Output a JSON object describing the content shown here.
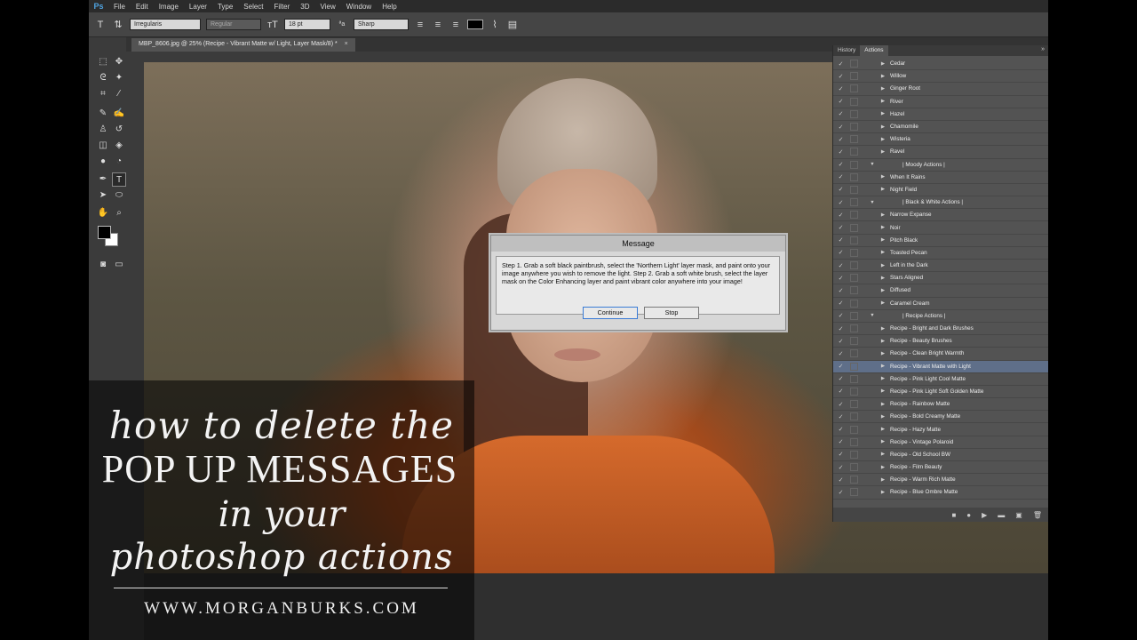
{
  "app": {
    "logo": "Ps",
    "menu": [
      "File",
      "Edit",
      "Image",
      "Layer",
      "Type",
      "Select",
      "Filter",
      "3D",
      "View",
      "Window",
      "Help"
    ]
  },
  "options": {
    "font_family": "Irregularis",
    "font_style": "Regular",
    "font_size": "18 pt",
    "aa_label": "ªa",
    "antialias": "Sharp"
  },
  "document": {
    "tab_title": "MBP_8606.jpg @ 25% (Recipe - Vibrant Matte w/ Light, Layer Mask/8) *",
    "tab_close": "×"
  },
  "dialog": {
    "title": "Message",
    "body": "Step 1. Grab a soft black paintbrush, select the 'Northern Light' layer mask, and paint onto your image anywhere you wish to remove the light. Step 2. Grab a soft white brush, select the layer mask on the Color Enhancing layer and paint vibrant color anywhere into your image!",
    "continue_label": "Continue",
    "stop_label": "Stop"
  },
  "panel": {
    "tabs": [
      "History",
      "Actions"
    ],
    "active_tab": "Actions",
    "actions": [
      {
        "label": "Cedar",
        "type": "action",
        "checked": true
      },
      {
        "label": "Willow",
        "type": "action",
        "checked": true
      },
      {
        "label": "Ginger Root",
        "type": "action",
        "checked": true
      },
      {
        "label": "River",
        "type": "action",
        "checked": true
      },
      {
        "label": "Hazel",
        "type": "action",
        "checked": true
      },
      {
        "label": "Chamomile",
        "type": "action",
        "checked": true
      },
      {
        "label": "Wisteria",
        "type": "action",
        "checked": true
      },
      {
        "label": "Ravel",
        "type": "action",
        "checked": true
      },
      {
        "label": "| Moody Actions |",
        "type": "group",
        "checked": true
      },
      {
        "label": "When It Rains",
        "type": "action",
        "checked": true
      },
      {
        "label": "Night Field",
        "type": "action",
        "checked": true
      },
      {
        "label": "| Black & White Actions |",
        "type": "group",
        "checked": true
      },
      {
        "label": "Narrow Expanse",
        "type": "action",
        "checked": true
      },
      {
        "label": "Noir",
        "type": "action",
        "checked": true
      },
      {
        "label": "Pitch Black",
        "type": "action",
        "checked": true
      },
      {
        "label": "Toasted Pecan",
        "type": "action",
        "checked": true
      },
      {
        "label": "Left in the Dark",
        "type": "action",
        "checked": true
      },
      {
        "label": "Stars Aligned",
        "type": "action",
        "checked": true
      },
      {
        "label": "Diffused",
        "type": "action",
        "checked": true
      },
      {
        "label": "Caramel Cream",
        "type": "action",
        "checked": true
      },
      {
        "label": "| Recipe Actions |",
        "type": "group",
        "checked": true
      },
      {
        "label": "Recipe - Bright and Dark Brushes",
        "type": "action",
        "checked": true
      },
      {
        "label": "Recipe - Beauty Brushes",
        "type": "action",
        "checked": true
      },
      {
        "label": "Recipe - Clean Bright Warmth",
        "type": "action",
        "checked": true
      },
      {
        "label": "Recipe - Vibrant Matte with Light",
        "type": "action",
        "checked": true,
        "selected": true
      },
      {
        "label": "Recipe - Pink Light Cool Matte",
        "type": "action",
        "checked": true
      },
      {
        "label": "Recipe - Pink Light Soft Golden Matte",
        "type": "action",
        "checked": true
      },
      {
        "label": "Recipe - Rainbow Matte",
        "type": "action",
        "checked": true
      },
      {
        "label": "Recipe - Bold Creamy Matte",
        "type": "action",
        "checked": true
      },
      {
        "label": "Recipe - Hazy Matte",
        "type": "action",
        "checked": true
      },
      {
        "label": "Recipe - Vintage Polaroid",
        "type": "action",
        "checked": true
      },
      {
        "label": "Recipe - Old School BW",
        "type": "action",
        "checked": true
      },
      {
        "label": "Recipe - Film Beauty",
        "type": "action",
        "checked": true
      },
      {
        "label": "Recipe - Warm Rich Matte",
        "type": "action",
        "checked": true
      },
      {
        "label": "Recipe - Blue Ombre Matte",
        "type": "action",
        "checked": true
      }
    ]
  },
  "overlay": {
    "line1": "how to delete the",
    "line2": "POP UP MESSAGES",
    "line3": "in your",
    "line4": "photoshop actions",
    "url": "WWW.MORGANBURKS.COM"
  }
}
